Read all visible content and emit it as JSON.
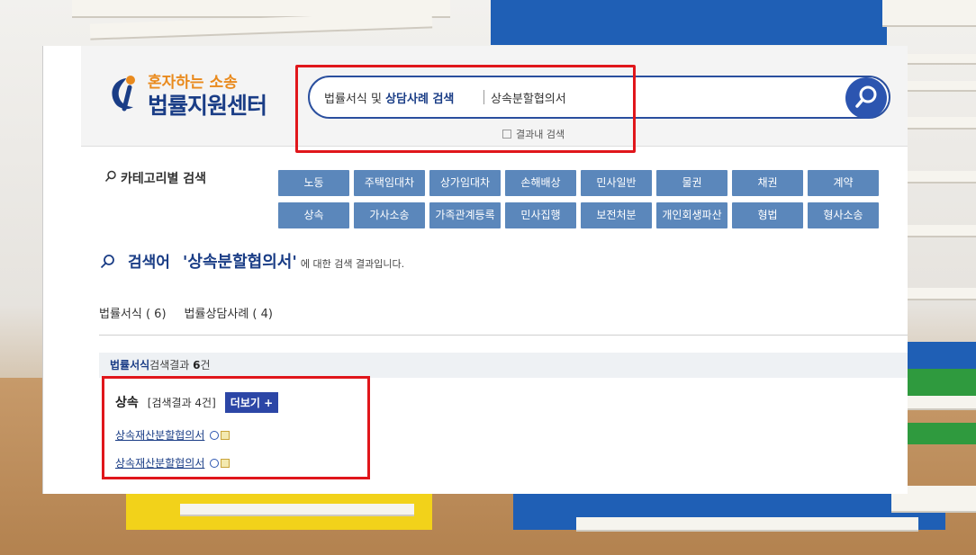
{
  "logo": {
    "subtitle": "혼자하는 소송",
    "title": "법률지원센터"
  },
  "search": {
    "scope_prefix": "법률서식 및 ",
    "scope_bold": "상담사례 검색",
    "value": "상속분할협의서",
    "in_result_label": "결과내 검색"
  },
  "category": {
    "title": "카테고리별 검색",
    "row1": [
      "노동",
      "주택임대차",
      "상가임대차",
      "손해배상",
      "민사일반",
      "물권",
      "채권",
      "계약"
    ],
    "row2": [
      "상속",
      "가사소송",
      "가족관계등록",
      "민사집행",
      "보전처분",
      "개인회생파산",
      "형법",
      "형사소송"
    ]
  },
  "result": {
    "label": "검색어",
    "keyword": "'상속분할협의서'",
    "tail": "에 대한 검색 결과입니다.",
    "tabs": [
      "법률서식 ( 6)",
      "법률상담사례 ( 4)"
    ],
    "section_bold": "법률서식",
    "section_text": "검색결과 ",
    "section_count": "6",
    "section_unit": "건",
    "group_title": "상속",
    "group_count": "[검색결과 4건]",
    "more_label": "더보기 +",
    "items": [
      "상속재산분할협의서",
      "상속재산분할협의서"
    ]
  },
  "colors": {
    "brand_navy": "#1a3d86",
    "brand_orange": "#e98a1d",
    "category_button": "#5b87bb",
    "highlight_red": "#e0161b",
    "search_button": "#2c55b0"
  }
}
